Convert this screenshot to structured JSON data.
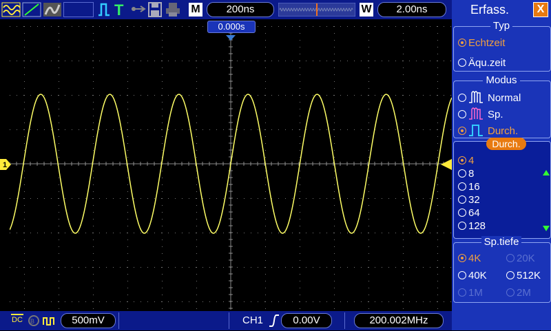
{
  "top": {
    "mode_badge": "M",
    "timebase": "200ns",
    "window_badge": "W",
    "window_time": "2.00ns",
    "trigger_offset": "0.000s"
  },
  "bottom": {
    "ch_voltage": "500mV",
    "trigger_channel": "CH1",
    "trigger_level": "0.00V",
    "frequency": "200.002MHz",
    "coupling": "DC"
  },
  "channel_marker": "1",
  "panel": {
    "title": "Erfass.",
    "close": "X",
    "typ_title": "Typ",
    "typ_options": [
      "Echtzeit",
      "Äqu.zeit"
    ],
    "modus_title": "Modus",
    "modus_options": [
      "Normal",
      "Sp.",
      "Durch."
    ],
    "durch_title": "Durch.",
    "durch_options": [
      "4",
      "8",
      "16",
      "32",
      "64",
      "128"
    ],
    "sptiefe_title": "Sp.tiefe",
    "sptiefe_options": [
      "4K",
      "20K",
      "40K",
      "512K",
      "1M",
      "2M"
    ]
  },
  "colors": {
    "trace": "#ffff66",
    "accent": "#f0a040",
    "panel": "#1a34b8",
    "bar": "#0b1a8a"
  },
  "waveform": {
    "cycles_visible": 6.4,
    "amplitude_fraction": 0.49
  }
}
